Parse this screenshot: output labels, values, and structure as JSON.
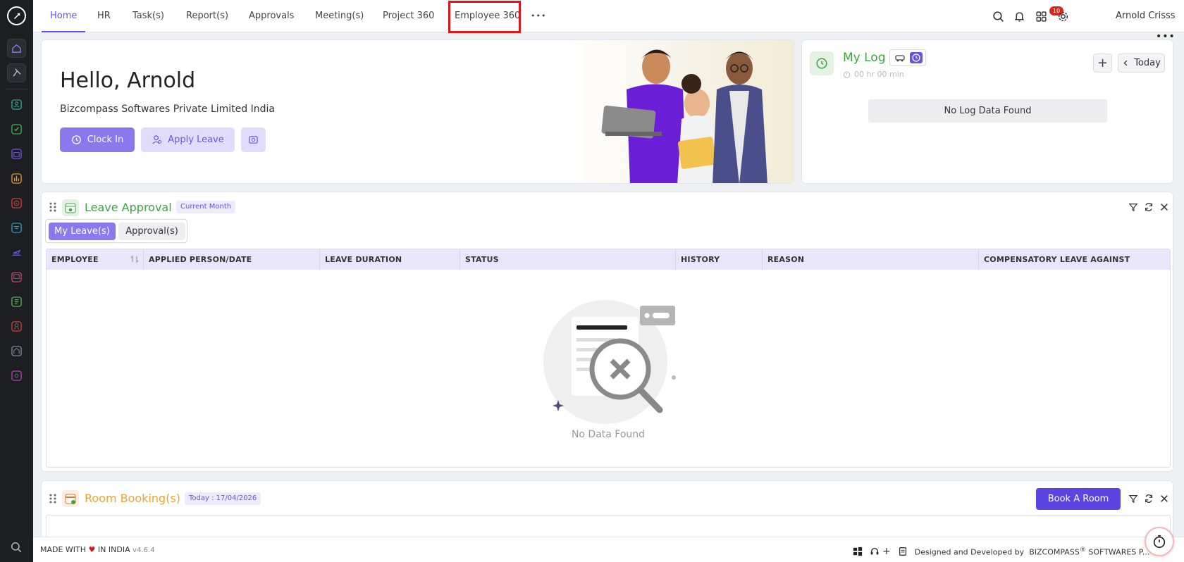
{
  "nav": {
    "tabs": [
      "Home",
      "HR",
      "Task(s)",
      "Report(s)",
      "Approvals",
      "Meeting(s)",
      "Project 360",
      "Employee 360"
    ],
    "more": "•••",
    "notification_count": "10",
    "user_name": "Arnold Crisss",
    "kebab": "•••"
  },
  "hero": {
    "greeting": "Hello, Arnold",
    "company": "Bizcompass Softwares Private Limited India",
    "clock_in": "Clock In",
    "apply_leave": "Apply Leave"
  },
  "my_log": {
    "title": "My Log",
    "time": "00 hr 00 min",
    "plus": "+",
    "today": "Today",
    "empty": "No Log Data Found"
  },
  "leave_approval": {
    "title": "Leave Approval",
    "badge": "Current Month",
    "seg_my": "My Leave(s)",
    "seg_approval": "Approval(s)",
    "columns": [
      "EMPLOYEE",
      "APPLIED PERSON/DATE",
      "LEAVE DURATION",
      "STATUS",
      "HISTORY",
      "REASON",
      "COMPENSATORY LEAVE AGAINST"
    ],
    "empty": "No Data Found"
  },
  "room_booking": {
    "title": "Room Booking(s)",
    "badge": "Today : 17/04/2026",
    "book_button": "Book A Room"
  },
  "footer": {
    "made_with": "MADE WITH",
    "in_india": "IN INDIA",
    "version": "v4.6.4",
    "designed_by": "Designed and Developed by",
    "brand": "BIZCOMPASS",
    "brand_suffix": " SOFTWARES P..."
  },
  "colors": {
    "accent": "#6a52e0",
    "green": "#3fa344",
    "orange": "#f0a430",
    "highlight": "#e0141b"
  }
}
